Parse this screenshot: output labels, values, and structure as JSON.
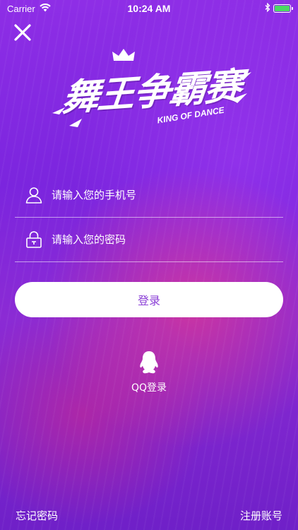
{
  "status_bar": {
    "carrier": "Carrier",
    "time": "10:24 AM"
  },
  "logo": {
    "title_cn": "舞王争霸赛",
    "subtitle_en": "KING OF DANCE"
  },
  "form": {
    "phone_placeholder": "请输入您的手机号",
    "password_placeholder": "请输入您的密码",
    "login_label": "登录"
  },
  "qq_login": {
    "label": "QQ登录"
  },
  "footer": {
    "forgot_password": "忘记密码",
    "register": "注册账号"
  },
  "colors": {
    "accent": "#8b3fd6",
    "background": "#8a2be2",
    "battery": "#4cd964"
  },
  "icons": {
    "close": "close-icon",
    "user": "user-icon",
    "lock": "lock-icon",
    "qq": "qq-penguin-icon",
    "wifi": "wifi-icon",
    "bluetooth": "bluetooth-icon",
    "battery": "battery-icon"
  }
}
